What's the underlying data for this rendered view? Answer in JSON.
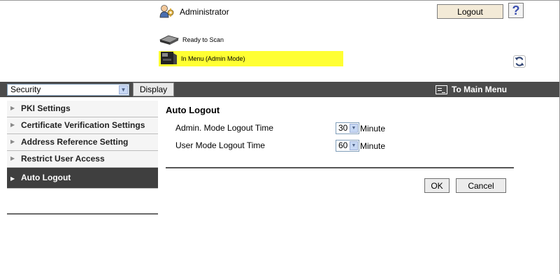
{
  "header": {
    "user_label": "Administrator",
    "logout_label": "Logout",
    "help_label": "?",
    "status_scan": "Ready to Scan",
    "status_menu": "In Menu (Admin Mode)"
  },
  "toolbar": {
    "category_selected": "Security",
    "display_label": "Display",
    "to_main_menu_label": "To Main Menu"
  },
  "sidebar": {
    "items": [
      {
        "label": "PKI Settings"
      },
      {
        "label": "Certificate Verification Settings"
      },
      {
        "label": "Address Reference Setting"
      },
      {
        "label": "Restrict User Access"
      },
      {
        "label": "Auto Logout"
      }
    ],
    "active_index": 4
  },
  "main": {
    "title": "Auto Logout",
    "rows": [
      {
        "label": "Admin. Mode Logout Time",
        "value": "30",
        "unit": "Minute"
      },
      {
        "label": "User Mode Logout Time",
        "value": "60",
        "unit": "Minute"
      }
    ],
    "ok_label": "OK",
    "cancel_label": "Cancel"
  },
  "colors": {
    "status_highlight": "#ffff33",
    "band": "#4b4b4b",
    "active_item": "#3f3f3f"
  }
}
